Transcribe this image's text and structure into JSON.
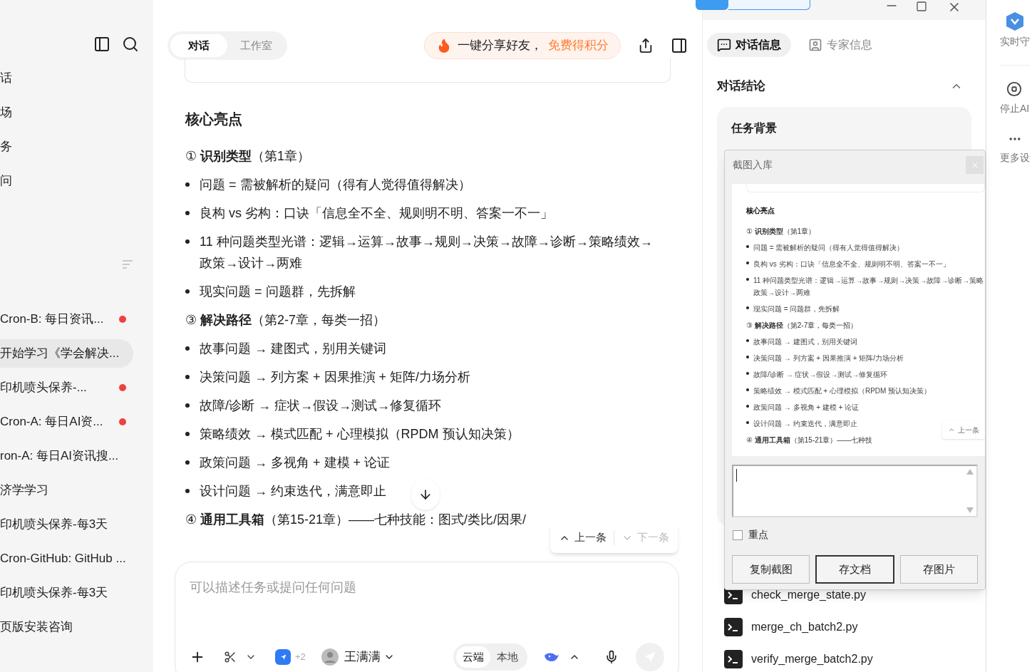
{
  "sidebar": {
    "nav_items": [
      {
        "label": "话"
      },
      {
        "label": "场"
      },
      {
        "label": "务"
      },
      {
        "label": "问"
      }
    ],
    "conversations": [
      {
        "title": "Cron-B: 每日资讯...",
        "unread": true,
        "selected": false
      },
      {
        "title": "开始学习《学会解决...",
        "unread": false,
        "selected": true
      },
      {
        "title": "印机喷头保养-...",
        "unread": true,
        "selected": false
      },
      {
        "title": "Cron-A: 每日AI资...",
        "unread": true,
        "selected": false
      },
      {
        "title": "ron-A: 每日AI资讯搜...",
        "unread": false,
        "selected": false
      },
      {
        "title": "济学学习",
        "unread": false,
        "selected": false
      },
      {
        "title": "印机喷头保养-每3天",
        "unread": false,
        "selected": false
      },
      {
        "title": "Cron-GitHub: GitHub ...",
        "unread": false,
        "selected": false
      },
      {
        "title": "印机喷头保养-每3天",
        "unread": false,
        "selected": false
      },
      {
        "title": "页版安装咨询",
        "unread": false,
        "selected": false
      }
    ]
  },
  "header": {
    "tabs": [
      {
        "label": "对话",
        "selected": true
      },
      {
        "label": "工作室",
        "selected": false
      }
    ],
    "share": {
      "text": "一键分享好友，",
      "highlight": "免费得积分"
    }
  },
  "article": {
    "heading": "核心亮点",
    "blocks": [
      {
        "kind": "section",
        "text": "① **识别类型**（第1章）"
      },
      {
        "kind": "bullet",
        "text": "问题 = 需被解析的疑问（得有人觉得值得解决）"
      },
      {
        "kind": "bullet",
        "text": "良构 vs 劣构：口诀「信息全不全、规则明不明、答案一不一」"
      },
      {
        "kind": "bullet",
        "text": "11 种问题类型光谱：逻辑→运算→故事→规则→决策→故障→诊断→策略绩效→政策→设计→两难"
      },
      {
        "kind": "bullet",
        "text": "现实问题 = 问题群，先拆解"
      },
      {
        "kind": "section",
        "text": "③ **解决路径**（第2-7章，每类一招）"
      },
      {
        "kind": "bullet",
        "text": "故事问题 → 建图式，别用关键词"
      },
      {
        "kind": "bullet",
        "text": "决策问题 → 列方案 + 因果推演 + 矩阵/力场分析"
      },
      {
        "kind": "bullet",
        "text": "故障/诊断 → 症状→假设→测试→修复循环"
      },
      {
        "kind": "bullet",
        "text": "策略绩效 → 模式匹配 + 心理模拟（RPDM 预认知决策）"
      },
      {
        "kind": "bullet",
        "text": "政策问题 → 多视角 + 建模 + 论证"
      },
      {
        "kind": "bullet",
        "text": "设计问题 → 约束迭代，满意即止"
      },
      {
        "kind": "section",
        "text": "④ **通用工具箱**（第15-21章）——七种技能：图式/类比/因果/"
      }
    ]
  },
  "nav": {
    "prev": "上一条",
    "next": "下一条"
  },
  "composer": {
    "placeholder": "可以描述任务或提问任何问题",
    "extra_count": "+2",
    "assistant": "王满满",
    "modes": [
      {
        "label": "云端",
        "selected": true
      },
      {
        "label": "本地",
        "selected": false
      }
    ]
  },
  "right_panel": {
    "tabs": [
      {
        "label": "对话信息",
        "selected": true
      },
      {
        "label": "专家信息",
        "selected": false
      }
    ],
    "section_title": "对话结论",
    "card_title": "任务背景",
    "files": [
      {
        "name": "check_merge_state.py"
      },
      {
        "name": "merge_ch_batch2.py"
      },
      {
        "name": "verify_merge_batch2.py"
      }
    ]
  },
  "side_strip": [
    {
      "label": "实时守"
    },
    {
      "label": "停止AI"
    },
    {
      "label": "更多设"
    }
  ],
  "dialog": {
    "title": "截图入库",
    "preview": {
      "heading": "核心亮点",
      "blocks": [
        {
          "kind": "section",
          "text": "① **识别类型**（第1章）"
        },
        {
          "kind": "bullet",
          "text": "问题 = 需被解析的疑问（得有人觉得值得解决）"
        },
        {
          "kind": "bullet",
          "text": "良构 vs 劣构：口诀「信息全不全、规则明不明、答案一不一」"
        },
        {
          "kind": "bullet",
          "text": "11 种问题类型光谱：逻辑→运算→故事→规则→决策→故障→诊断→策略"
        },
        {
          "kind": "continuation",
          "text": "政策→设计→两难"
        },
        {
          "kind": "bullet",
          "text": "现实问题 = 问题群，先拆解"
        },
        {
          "kind": "section",
          "text": "③ **解决路径**（第2-7章，每类一招）"
        },
        {
          "kind": "bullet",
          "text": "故事问题 → 建图式，别用关键词"
        },
        {
          "kind": "bullet",
          "text": "决策问题 → 列方案 + 因果推演 + 矩阵/力场分析"
        },
        {
          "kind": "bullet",
          "text": "故障/诊断 → 症状→假设→测试→修复循环"
        },
        {
          "kind": "bullet",
          "text": "策略绩效 → 模式匹配 + 心理模拟（RPDM 预认知决策）"
        },
        {
          "kind": "bullet",
          "text": "政策问题 → 多视角 + 建模 + 论证"
        },
        {
          "kind": "bullet",
          "text": "设计问题 → 约束迭代，满意即止"
        },
        {
          "kind": "section",
          "text": "④ **通用工具箱**（第15-21章）——七种技"
        }
      ],
      "prev": "上一条"
    },
    "important": {
      "label": "重点",
      "checked": false
    },
    "buttons": [
      {
        "label": "复制截图",
        "default": false
      },
      {
        "label": "存文档",
        "default": true
      },
      {
        "label": "存图片",
        "default": false
      }
    ]
  }
}
